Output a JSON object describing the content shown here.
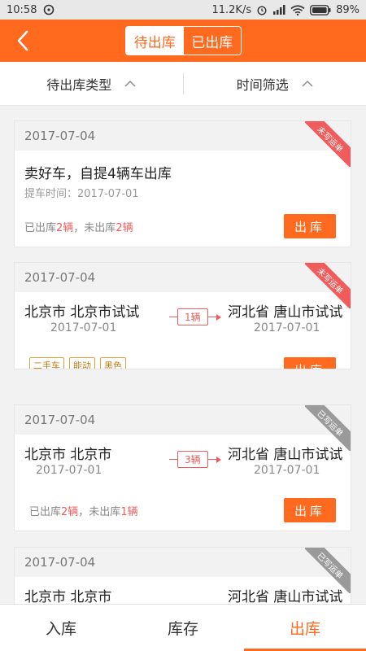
{
  "statusbar": {
    "time": "10:58",
    "speed": "11.2K/s",
    "battery": "89%"
  },
  "header": {
    "tabs": [
      {
        "label": "待出库",
        "active": true
      },
      {
        "label": "已出库",
        "active": false
      }
    ]
  },
  "filters": [
    {
      "label": "待出库类型"
    },
    {
      "label": "时间筛选"
    }
  ],
  "cards": [
    {
      "date": "2017-07-04",
      "ribbon": "未写运单",
      "ribbon_color": "#f05c5c",
      "title": "卖好车，自提4辆车出库",
      "sub": "提车时间：2017-07-01",
      "status": {
        "out_prefix": "已出库",
        "out_num": "2辆",
        "sep": "，未出库",
        "not_num": "2辆"
      },
      "button": "出库"
    },
    {
      "date": "2017-07-04",
      "ribbon": "未写运单",
      "ribbon_color": "#f05c5c",
      "from": "北京市 北京市试试",
      "from_date": "2017-07-01",
      "count": "1辆",
      "to": "河北省 唐山市试试",
      "to_date": "2017-07-01",
      "tags": [
        "二手车",
        "能动",
        "黑色"
      ],
      "button": "出库"
    },
    {
      "date": "2017-07-04",
      "ribbon": "已写运单",
      "ribbon_color": "#9a9a9a",
      "from": "北京市 北京市",
      "from_date": "2017-07-01",
      "count": "3辆",
      "to": "河北省 唐山市试试",
      "to_date": "2017-07-01",
      "status": {
        "out_prefix": "已出库",
        "out_num": "2辆",
        "sep": "，未出库",
        "not_num": "1辆"
      },
      "button": "出库"
    },
    {
      "date": "2017-07-04",
      "ribbon": "已写运单",
      "ribbon_color": "#9a9a9a",
      "from": "北京市 北京市",
      "to": "河北省 唐山市试试"
    }
  ],
  "bottomnav": [
    {
      "label": "入库",
      "active": false
    },
    {
      "label": "库存",
      "active": false
    },
    {
      "label": "出库",
      "active": true
    }
  ]
}
